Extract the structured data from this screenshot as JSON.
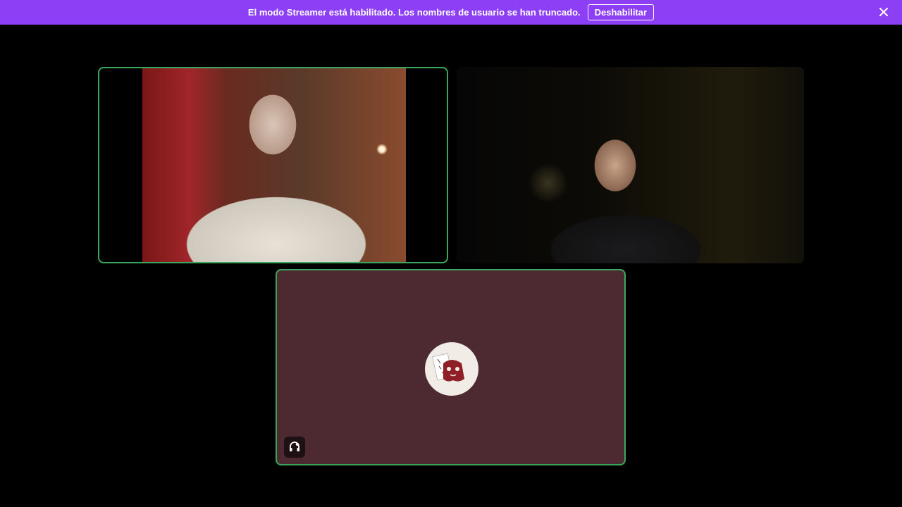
{
  "notice": {
    "message": "El modo Streamer está habilitado. Los nombres de usuario se han truncado.",
    "button_label": "Deshabilitar",
    "close_icon": "close-icon",
    "background": "#8d3ff6"
  },
  "tiles": [
    {
      "kind": "camera",
      "speaking": true
    },
    {
      "kind": "camera",
      "speaking": false
    },
    {
      "kind": "avatar",
      "speaking": true,
      "status_icon": "headphones-deafened-icon"
    }
  ],
  "colors": {
    "speaking_border": "#3ba55c",
    "avatar_tile_bg": "#4d2a31",
    "page_bg": "#000000"
  }
}
